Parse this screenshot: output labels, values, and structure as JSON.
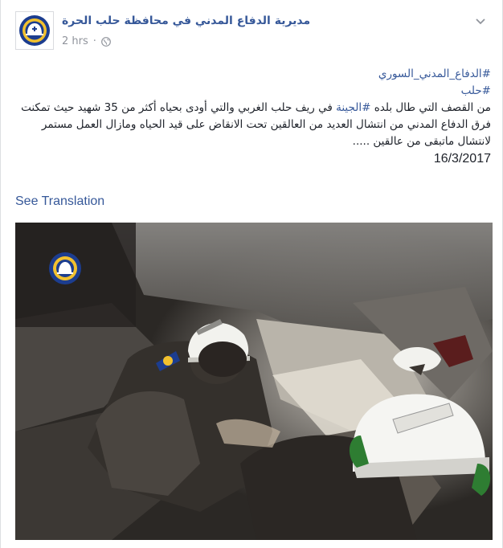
{
  "post": {
    "page_name": "مديرية الدفاع المدني في محافظة حلب الحرة",
    "timestamp": "2 hrs",
    "privacy_icon": "globe-icon",
    "options_icon": "chevron-down-icon",
    "hashtags": [
      "#الدفاع_المدني_السوري",
      "#حلب"
    ],
    "body_prefix": "من القصف التي طال بلده ",
    "body_hashtag": "#الجينة",
    "body_rest": " في ريف حلب الغربي والتي أودى بحياه أكثر من 35 شهيد حيث تمكنت فرق الدفاع المدني من انتشال العديد من العالقين تحت الانقاض على قيد الحياه ومازال العمل مستمر لانتشال ماتبقى من عالقين .....",
    "date": "16/3/2017",
    "see_translation": "See Translation"
  },
  "colors": {
    "link": "#365899",
    "meta": "#90949c",
    "text": "#1d2129",
    "helmet_white": "#f2f2ee",
    "logo_yellow": "#f2c12e",
    "logo_blue": "#1c3d8f"
  }
}
